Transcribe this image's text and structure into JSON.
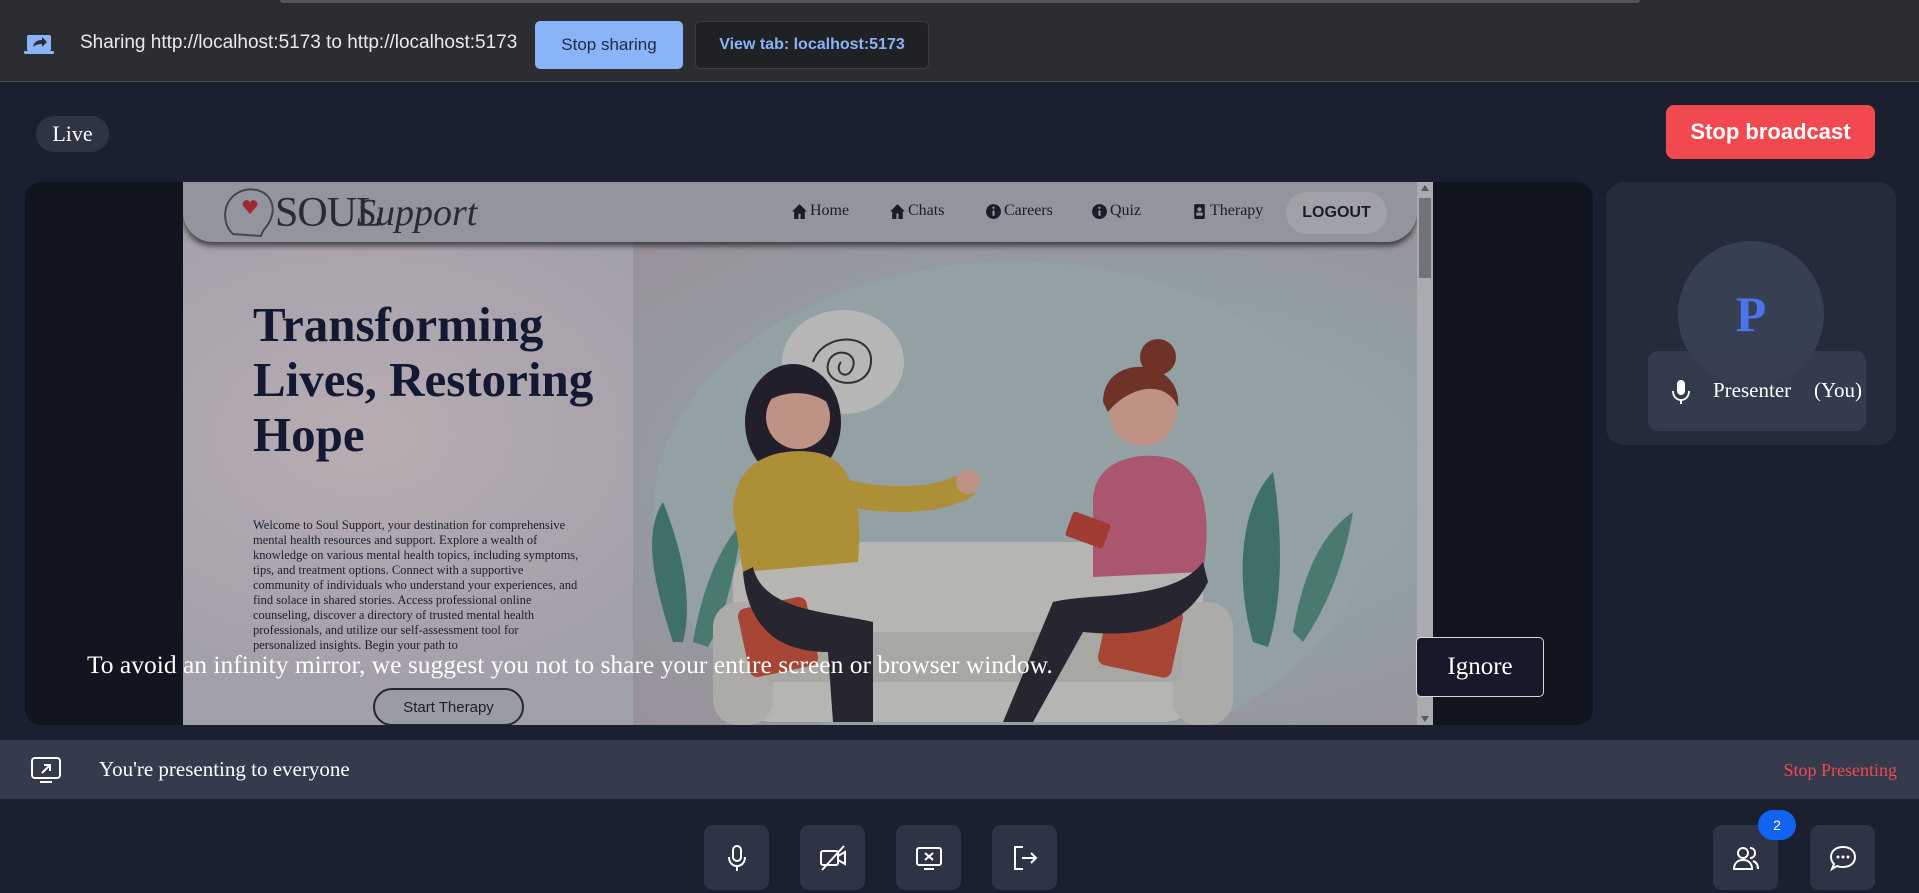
{
  "share_bar": {
    "message": "Sharing http://localhost:5173 to http://localhost:5173",
    "stop_sharing_label": "Stop sharing",
    "view_tab_label": "View tab: localhost:5173"
  },
  "header": {
    "live_label": "Live",
    "stop_broadcast_label": "Stop broadcast"
  },
  "shared_site": {
    "logo_text": "SOUL",
    "logo_script": "Support",
    "nav": [
      "Home",
      "Chats",
      "Careers",
      "Quiz",
      "Therapy"
    ],
    "logout_label": "LOGOUT",
    "hero_title": "Transforming Lives, Restoring Hope",
    "hero_desc": "Welcome to Soul Support, your destination for comprehensive mental health resources and support. Explore a wealth of knowledge on various mental health topics, including symptoms, tips, and treatment options. Connect with a supportive community of individuals who understand your experiences, and find solace in shared stories. Access professional online counseling, discover a directory of trusted mental health professionals, and utilize our self-assessment tool for personalized insights. Begin your path to",
    "start_therapy_label": "Start Therapy"
  },
  "mirror_warning": {
    "message": "To avoid an infinity mirror, we suggest you not to share your entire screen or browser window.",
    "ignore_label": "Ignore"
  },
  "participant": {
    "initial": "P",
    "name": "Presenter",
    "suffix": "(You)"
  },
  "presenting_bar": {
    "message": "You're presenting to everyone",
    "stop_label": "Stop Presenting"
  },
  "controls": {
    "participants_count": "2"
  },
  "colors": {
    "accent_blue": "#8ab4f8",
    "danger": "#f2484f",
    "badge": "#1164f2",
    "avatar_letter": "#4d74ec"
  }
}
